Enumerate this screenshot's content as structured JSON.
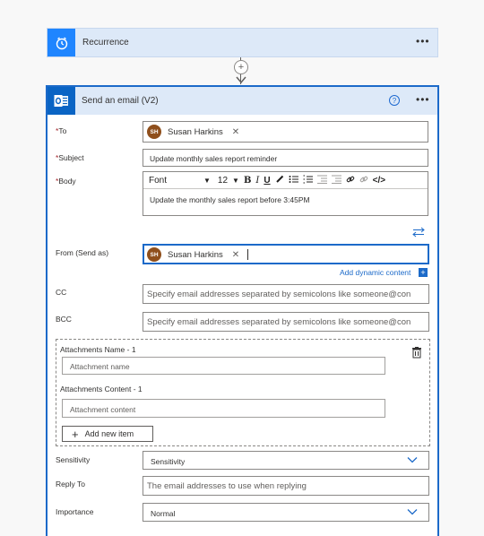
{
  "recurrence": {
    "title": "Recurrence",
    "more": "•••"
  },
  "connector": {
    "plus": "+"
  },
  "email": {
    "title": "Send an email (V2)",
    "help": "?",
    "more": "•••",
    "to": {
      "required": "*",
      "label": "To",
      "recipient_initials": "SH",
      "recipient_name": "Susan Harkins",
      "remove": "✕"
    },
    "subject": {
      "required": "*",
      "label": "Subject",
      "value": "Update monthly sales report reminder"
    },
    "body": {
      "required": "*",
      "label": "Body",
      "font": "Font",
      "font_size": "12",
      "bold": "B",
      "italic": "I",
      "underline": "U",
      "value": "Update the monthly sales report before 3:45PM"
    },
    "from": {
      "label": "From (Send as)",
      "sender_initials": "SH",
      "sender_name": "Susan Harkins",
      "remove": "✕"
    },
    "add_dynamic": "Add dynamic content",
    "add_dynamic_icon": "+",
    "cc": {
      "label": "CC",
      "placeholder": "Specify email addresses separated by semicolons like someone@con"
    },
    "bcc": {
      "label": "BCC",
      "placeholder": "Specify email addresses separated by semicolons like someone@con"
    },
    "attachments": {
      "name_label": "Attachments Name - 1",
      "name_placeholder": "Attachment name",
      "content_label": "Attachments Content - 1",
      "content_placeholder": "Attachment content",
      "add_item": "Add new item",
      "add_icon": "+"
    },
    "sensitivity": {
      "label": "Sensitivity",
      "value": "Sensitivity"
    },
    "reply_to": {
      "label": "Reply To",
      "placeholder": "The email addresses to use when replying"
    },
    "importance": {
      "label": "Importance",
      "value": "Normal"
    }
  },
  "colors": {
    "accent": "#1c6ac9",
    "header_bg": "#dde9f8",
    "required": "#a4262c",
    "avatar": "#8f4f1c"
  }
}
